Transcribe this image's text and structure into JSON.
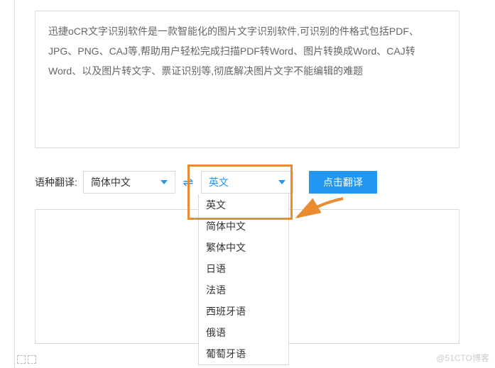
{
  "source_text": "迅捷oCR文字识别软件是一款智能化的图片文字识别软件,可识别的件格式包括PDF、JPG、PNG、CAJ等,帮助用户轻松完成扫描PDF转Word、图片转换成Word、CAJ转Word、以及图片转文字、票证识别等,彻底解决图片文字不能编辑的难题",
  "row": {
    "label": "语种翻译:",
    "from_value": "简体中文",
    "to_value": "英文",
    "button": "点击翻译"
  },
  "dropdown": {
    "options": [
      "英文",
      "简体中文",
      "繁体中文",
      "日语",
      "法语",
      "西班牙语",
      "俄语",
      "葡萄牙语"
    ]
  },
  "watermark": "@51CTO博客"
}
